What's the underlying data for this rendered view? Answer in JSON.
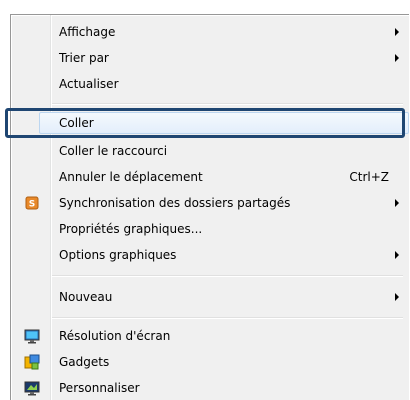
{
  "menu": {
    "items": [
      {
        "label": "Affichage",
        "submenu": true
      },
      {
        "label": "Trier par",
        "submenu": true
      },
      {
        "label": "Actualiser"
      },
      {
        "label": "Coller",
        "highlighted": true
      },
      {
        "label": "Coller le raccourci"
      },
      {
        "label": "Annuler le déplacement",
        "shortcut": "Ctrl+Z"
      },
      {
        "label": "Synchronisation des dossiers partagés",
        "submenu": true,
        "icon": "sync-icon",
        "icon_letter": "S"
      },
      {
        "label": "Propriétés graphiques..."
      },
      {
        "label": "Options graphiques",
        "submenu": true
      },
      {
        "label": "Nouveau",
        "submenu": true
      },
      {
        "label": "Résolution d'écran",
        "icon": "display-icon"
      },
      {
        "label": "Gadgets",
        "icon": "gadgets-icon"
      },
      {
        "label": "Personnaliser",
        "icon": "personalize-icon"
      }
    ]
  },
  "colors": {
    "menu_bg": "#f0f0f0",
    "highlight_border": "#1f4672",
    "sync_icon": "#e8892a"
  }
}
